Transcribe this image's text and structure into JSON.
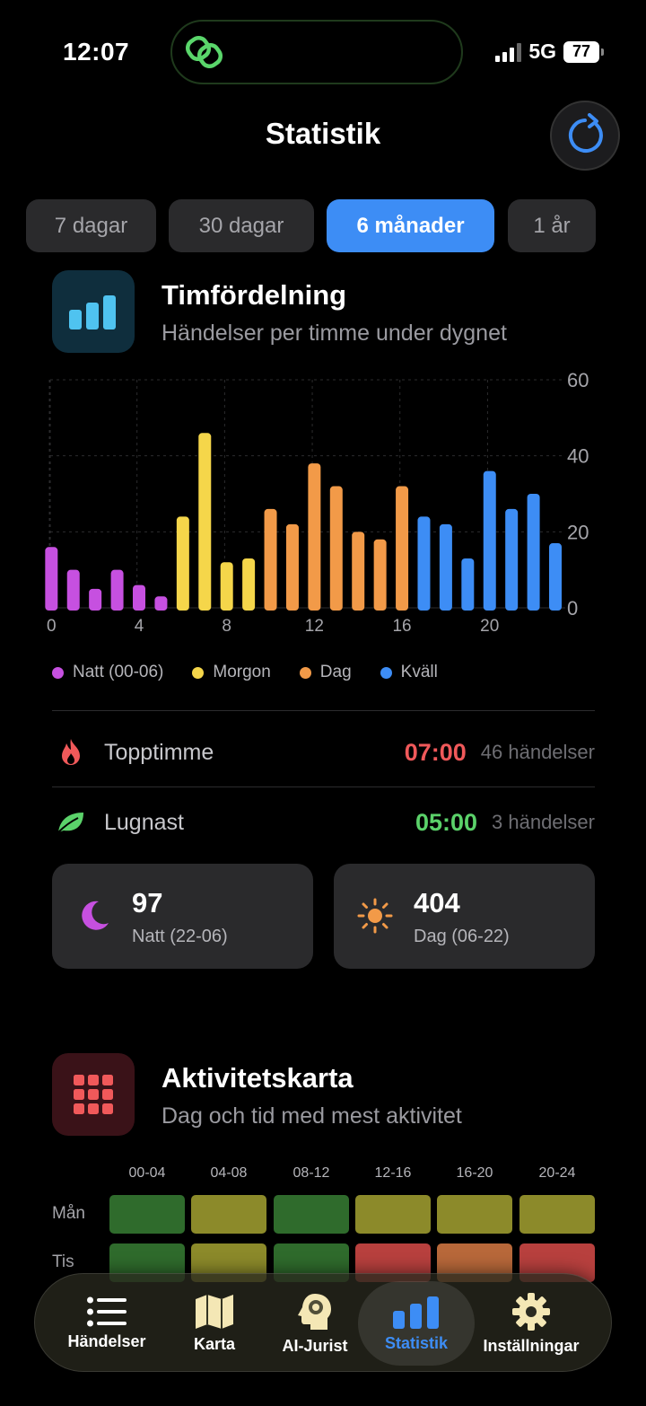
{
  "status": {
    "time": "12:07",
    "network": "5G",
    "battery": "77"
  },
  "header": {
    "title": "Statistik"
  },
  "ranges": [
    {
      "label": "7 dagar",
      "active": false
    },
    {
      "label": "30 dagar",
      "active": false
    },
    {
      "label": "6 månader",
      "active": true
    },
    {
      "label": "1 år",
      "active": false
    }
  ],
  "hourly": {
    "title": "Timfördelning",
    "subtitle": "Händelser per timme under dygnet"
  },
  "chart_data": {
    "type": "bar",
    "categories": [
      0,
      1,
      2,
      3,
      4,
      5,
      6,
      7,
      8,
      9,
      10,
      11,
      12,
      13,
      14,
      15,
      16,
      17,
      18,
      19,
      20,
      21,
      22,
      23
    ],
    "values": [
      16,
      10,
      5,
      10,
      6,
      3,
      24,
      46,
      12,
      13,
      26,
      22,
      38,
      32,
      20,
      18,
      32,
      24,
      22,
      13,
      36,
      26,
      30,
      17
    ],
    "x_tick_labels": [
      "0",
      "4",
      "8",
      "12",
      "16",
      "20"
    ],
    "y_tick_labels": [
      "0",
      "20",
      "40",
      "60"
    ],
    "ylim": [
      0,
      60
    ],
    "grid": true,
    "legend": "bottom",
    "legend_entries": [
      {
        "name": "Natt (00-06)",
        "color": "#c650e0"
      },
      {
        "name": "Morgon",
        "color": "#f5d64a"
      },
      {
        "name": "Dag",
        "color": "#f29a48"
      },
      {
        "name": "Kväll",
        "color": "#3d8df5"
      }
    ]
  },
  "peak": {
    "label": "Topptimme",
    "time": "07:00",
    "count": "46 händelser",
    "color": "#f0595a"
  },
  "calm": {
    "label": "Lugnast",
    "time": "05:00",
    "count": "3 händelser",
    "color": "#5bd26a"
  },
  "night_card": {
    "value": "97",
    "label": "Natt (22-06)"
  },
  "day_card": {
    "value": "404",
    "label": "Dag (06-22)"
  },
  "heatmap": {
    "title": "Aktivitetskarta",
    "subtitle": "Dag och tid med mest aktivitet",
    "columns": [
      "00-04",
      "04-08",
      "08-12",
      "12-16",
      "16-20",
      "20-24"
    ],
    "rows": [
      {
        "day": "Mån",
        "colors": [
          "#2f6b2c",
          "#8c8a2a",
          "#2f6b2c",
          "#8c8a2a",
          "#8c8a2a",
          "#8c8a2a"
        ]
      },
      {
        "day": "Tis",
        "colors": [
          "#2f6b2c",
          "#8c8a2a",
          "#2f6b2c",
          "#b8403e",
          "#b8683a",
          "#b8403e"
        ]
      }
    ]
  },
  "tabs": [
    {
      "label": "Händelser",
      "icon": "list-icon",
      "active": false
    },
    {
      "label": "Karta",
      "icon": "map-icon",
      "active": false
    },
    {
      "label": "AI-Jurist",
      "icon": "brain-head-icon",
      "active": false
    },
    {
      "label": "Statistik",
      "icon": "bar-chart-icon",
      "active": true
    },
    {
      "label": "Inställningar",
      "icon": "gear-icon",
      "active": false
    }
  ]
}
